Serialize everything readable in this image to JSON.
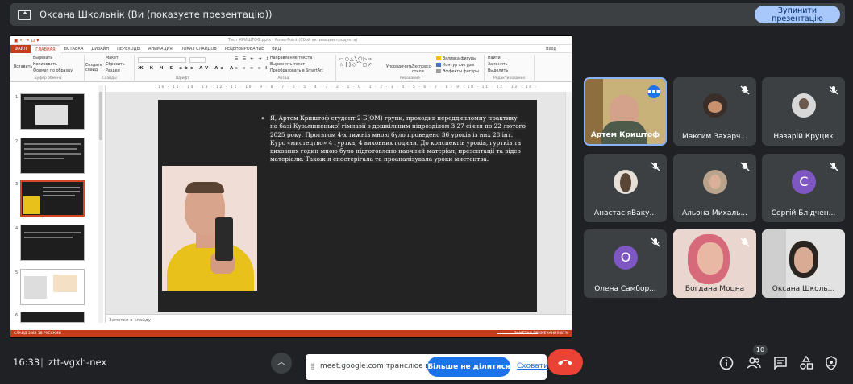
{
  "topbar": {
    "title": "Оксана Школьнік (Ви (показуєте презентацію))",
    "stop_button": "Зупинити презентацію"
  },
  "powerpoint": {
    "title": "Тест КРИШТОФ.pptx - PowerPoint (Сбой активации продукта)",
    "tabs": [
      "ФАЙЛ",
      "ГЛАВНАЯ",
      "ВСТАВКА",
      "ДИЗАЙН",
      "ПЕРЕХОДЫ",
      "АНИМАЦИЯ",
      "ПОКАЗ СЛАЙДОВ",
      "РЕЦЕНЗИРОВАНИЕ",
      "ВИД"
    ],
    "signin": "Вход",
    "ribbon": {
      "paste": "Вставить",
      "cut": "Вырезать",
      "copy": "Копировать",
      "format_painter": "Формат по образцу",
      "clipboard_group": "Буфер обмена",
      "new_slide": "Создать слайд",
      "layout": "Макет",
      "reset": "Сбросить",
      "section": "Раздел",
      "slides_group": "Слайды",
      "font_group": "Шрифт",
      "text_direction": "Направление текста",
      "align_text": "Выровнять текст",
      "smartart": "Преобразовать в SmartArt",
      "paragraph_group": "Абзац",
      "arrange": "Упорядочить",
      "quick_styles": "Экспресс-стили",
      "shape_fill": "Заливка фигуры",
      "shape_outline": "Контур фигуры",
      "shape_effects": "Эффекты фигуры",
      "drawing_group": "Рисование",
      "find": "Найти",
      "replace": "Заменить",
      "select": "Выделить",
      "editing_group": "Редактирование"
    },
    "ruler": "16 · 15 · 14 · 13 · 12 · 11 · 10 · 9 · 8 · 7 · 6 · 5 · 4 · 3 · 2 · 1 · 0 · 1 · 2 · 3 · 4 · 5 · 6 · 7 · 8 · 9 · 10 · 11 · 12 · 13 · 14 · 15 · 16",
    "thumb_numbers": [
      "1",
      "2",
      "3",
      "4",
      "5",
      "6"
    ],
    "slide_text": "Я, Артем Криштоф студент 2-Б(ОМ) групи, проходив переддипломну практику на базі Кузьминецької гімназії з дошкільним підрозділом З 27 січня по 22 лютого 2025 року. Протягом 4-х тижнів мною було проведено 36 уроків із них 28 інт. Курс «мистецтво» 4 гуртка, 4 виховних години. До конспектів уроків, гуртків та виховних годин мною було підготовлено наочний матеріал, презентації та відео матеріали. Також я спостерігала та проаналізувала уроки мистецтва.",
    "notes_placeholder": "Заметки к слайду",
    "status_left": "СЛАЙД 3 ИЗ 18     РУССКИЙ",
    "status_right": "ЗАМЕТКИ     ПРИМЕЧАНИЯ     87%"
  },
  "participants": [
    {
      "name": "Артем Криштоф",
      "speaking": true
    },
    {
      "name": "Максим Захарч...",
      "muted": true
    },
    {
      "name": "Назарій Круцик",
      "muted": true
    },
    {
      "name": "АнастасіяВаку...",
      "muted": true
    },
    {
      "name": "Альона Михаль...",
      "muted": true
    },
    {
      "name": "Сергій Блідчен...",
      "muted": true,
      "initial": "С",
      "color": "#7e57c2"
    },
    {
      "name": "Олена Самбор...",
      "muted": true,
      "initial": "О",
      "color": "#7e57c2"
    },
    {
      "name": "Богдана Моцна",
      "muted": true
    },
    {
      "name": "Оксана Школь...",
      "muted": false
    }
  ],
  "bottombar": {
    "time": "16:33",
    "separator": "|",
    "meeting_code": "ztt-vgxh-nex",
    "people_count": "10"
  },
  "share_banner": {
    "text": "meet.google.com транслює вікно.",
    "stop_sharing": "Більше не ділитися",
    "hide": "Сховати"
  },
  "colors": {
    "background": "#202124",
    "accent": "#a8c7fa",
    "powerpoint_orange": "#c43e1c",
    "end_call": "#ea4335",
    "primary_blue": "#1a73e8"
  }
}
